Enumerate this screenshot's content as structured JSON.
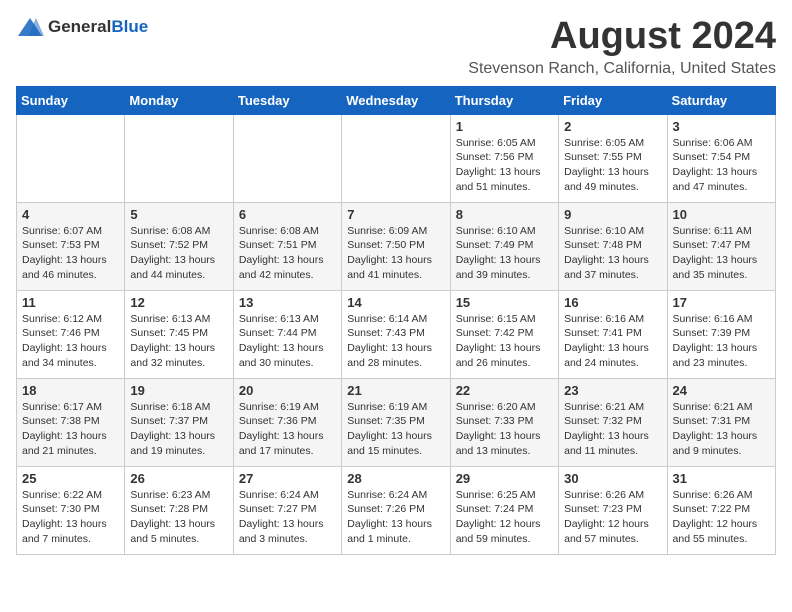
{
  "logo": {
    "general": "General",
    "blue": "Blue"
  },
  "header": {
    "title": "August 2024",
    "subtitle": "Stevenson Ranch, California, United States"
  },
  "weekdays": [
    "Sunday",
    "Monday",
    "Tuesday",
    "Wednesday",
    "Thursday",
    "Friday",
    "Saturday"
  ],
  "weeks": [
    [
      {
        "day": "",
        "info": ""
      },
      {
        "day": "",
        "info": ""
      },
      {
        "day": "",
        "info": ""
      },
      {
        "day": "",
        "info": ""
      },
      {
        "day": "1",
        "info": "Sunrise: 6:05 AM\nSunset: 7:56 PM\nDaylight: 13 hours\nand 51 minutes."
      },
      {
        "day": "2",
        "info": "Sunrise: 6:05 AM\nSunset: 7:55 PM\nDaylight: 13 hours\nand 49 minutes."
      },
      {
        "day": "3",
        "info": "Sunrise: 6:06 AM\nSunset: 7:54 PM\nDaylight: 13 hours\nand 47 minutes."
      }
    ],
    [
      {
        "day": "4",
        "info": "Sunrise: 6:07 AM\nSunset: 7:53 PM\nDaylight: 13 hours\nand 46 minutes."
      },
      {
        "day": "5",
        "info": "Sunrise: 6:08 AM\nSunset: 7:52 PM\nDaylight: 13 hours\nand 44 minutes."
      },
      {
        "day": "6",
        "info": "Sunrise: 6:08 AM\nSunset: 7:51 PM\nDaylight: 13 hours\nand 42 minutes."
      },
      {
        "day": "7",
        "info": "Sunrise: 6:09 AM\nSunset: 7:50 PM\nDaylight: 13 hours\nand 41 minutes."
      },
      {
        "day": "8",
        "info": "Sunrise: 6:10 AM\nSunset: 7:49 PM\nDaylight: 13 hours\nand 39 minutes."
      },
      {
        "day": "9",
        "info": "Sunrise: 6:10 AM\nSunset: 7:48 PM\nDaylight: 13 hours\nand 37 minutes."
      },
      {
        "day": "10",
        "info": "Sunrise: 6:11 AM\nSunset: 7:47 PM\nDaylight: 13 hours\nand 35 minutes."
      }
    ],
    [
      {
        "day": "11",
        "info": "Sunrise: 6:12 AM\nSunset: 7:46 PM\nDaylight: 13 hours\nand 34 minutes."
      },
      {
        "day": "12",
        "info": "Sunrise: 6:13 AM\nSunset: 7:45 PM\nDaylight: 13 hours\nand 32 minutes."
      },
      {
        "day": "13",
        "info": "Sunrise: 6:13 AM\nSunset: 7:44 PM\nDaylight: 13 hours\nand 30 minutes."
      },
      {
        "day": "14",
        "info": "Sunrise: 6:14 AM\nSunset: 7:43 PM\nDaylight: 13 hours\nand 28 minutes."
      },
      {
        "day": "15",
        "info": "Sunrise: 6:15 AM\nSunset: 7:42 PM\nDaylight: 13 hours\nand 26 minutes."
      },
      {
        "day": "16",
        "info": "Sunrise: 6:16 AM\nSunset: 7:41 PM\nDaylight: 13 hours\nand 24 minutes."
      },
      {
        "day": "17",
        "info": "Sunrise: 6:16 AM\nSunset: 7:39 PM\nDaylight: 13 hours\nand 23 minutes."
      }
    ],
    [
      {
        "day": "18",
        "info": "Sunrise: 6:17 AM\nSunset: 7:38 PM\nDaylight: 13 hours\nand 21 minutes."
      },
      {
        "day": "19",
        "info": "Sunrise: 6:18 AM\nSunset: 7:37 PM\nDaylight: 13 hours\nand 19 minutes."
      },
      {
        "day": "20",
        "info": "Sunrise: 6:19 AM\nSunset: 7:36 PM\nDaylight: 13 hours\nand 17 minutes."
      },
      {
        "day": "21",
        "info": "Sunrise: 6:19 AM\nSunset: 7:35 PM\nDaylight: 13 hours\nand 15 minutes."
      },
      {
        "day": "22",
        "info": "Sunrise: 6:20 AM\nSunset: 7:33 PM\nDaylight: 13 hours\nand 13 minutes."
      },
      {
        "day": "23",
        "info": "Sunrise: 6:21 AM\nSunset: 7:32 PM\nDaylight: 13 hours\nand 11 minutes."
      },
      {
        "day": "24",
        "info": "Sunrise: 6:21 AM\nSunset: 7:31 PM\nDaylight: 13 hours\nand 9 minutes."
      }
    ],
    [
      {
        "day": "25",
        "info": "Sunrise: 6:22 AM\nSunset: 7:30 PM\nDaylight: 13 hours\nand 7 minutes."
      },
      {
        "day": "26",
        "info": "Sunrise: 6:23 AM\nSunset: 7:28 PM\nDaylight: 13 hours\nand 5 minutes."
      },
      {
        "day": "27",
        "info": "Sunrise: 6:24 AM\nSunset: 7:27 PM\nDaylight: 13 hours\nand 3 minutes."
      },
      {
        "day": "28",
        "info": "Sunrise: 6:24 AM\nSunset: 7:26 PM\nDaylight: 13 hours\nand 1 minute."
      },
      {
        "day": "29",
        "info": "Sunrise: 6:25 AM\nSunset: 7:24 PM\nDaylight: 12 hours\nand 59 minutes."
      },
      {
        "day": "30",
        "info": "Sunrise: 6:26 AM\nSunset: 7:23 PM\nDaylight: 12 hours\nand 57 minutes."
      },
      {
        "day": "31",
        "info": "Sunrise: 6:26 AM\nSunset: 7:22 PM\nDaylight: 12 hours\nand 55 minutes."
      }
    ]
  ]
}
